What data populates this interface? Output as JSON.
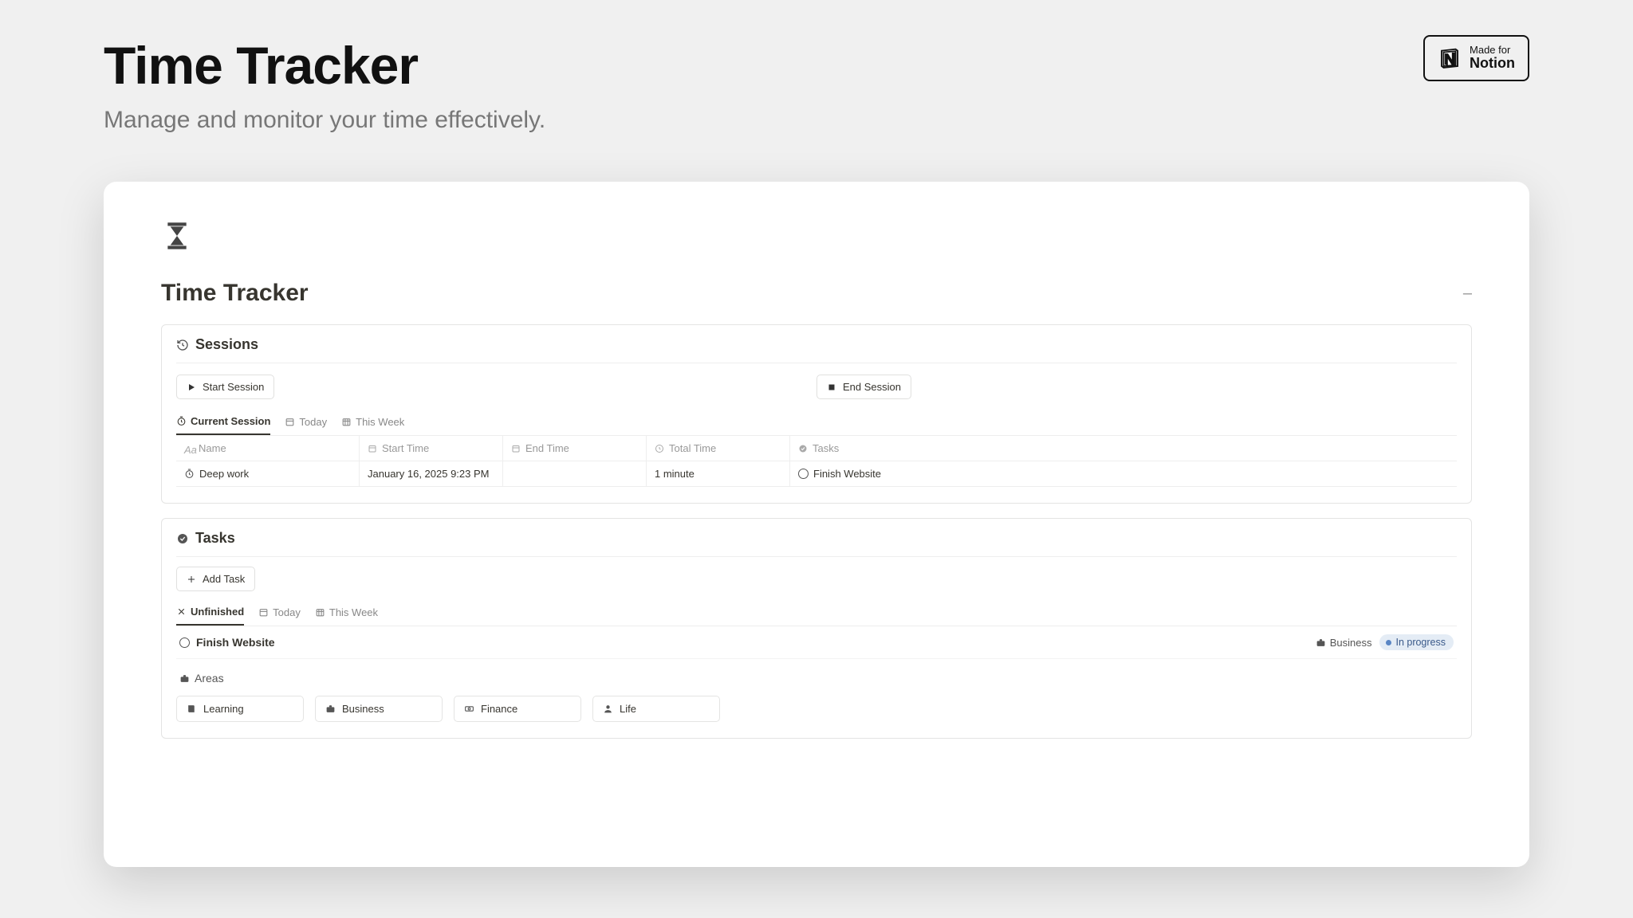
{
  "header": {
    "title": "Time Tracker",
    "subtitle": "Manage and monitor your time effectively.",
    "badge_line1": "Made for",
    "badge_line2": "Notion"
  },
  "page": {
    "title": "Time Tracker"
  },
  "sessions": {
    "heading": "Sessions",
    "start_label": "Start Session",
    "end_label": "End Session",
    "tabs": [
      "Current Session",
      "Today",
      "This Week"
    ],
    "active_tab": 0,
    "columns": [
      "Name",
      "Start Time",
      "End Time",
      "Total Time",
      "Tasks"
    ],
    "row": {
      "name": "Deep work",
      "start": "January 16, 2025 9:23 PM",
      "end": "",
      "total": "1 minute",
      "task": "Finish Website"
    }
  },
  "tasks": {
    "heading": "Tasks",
    "add_label": "Add Task",
    "tabs": [
      "Unfinished",
      "Today",
      "This Week"
    ],
    "active_tab": 0,
    "row": {
      "name": "Finish Website",
      "area": "Business",
      "status": "In progress"
    }
  },
  "areas": {
    "heading": "Areas",
    "items": [
      "Learning",
      "Business",
      "Finance",
      "Life"
    ]
  }
}
